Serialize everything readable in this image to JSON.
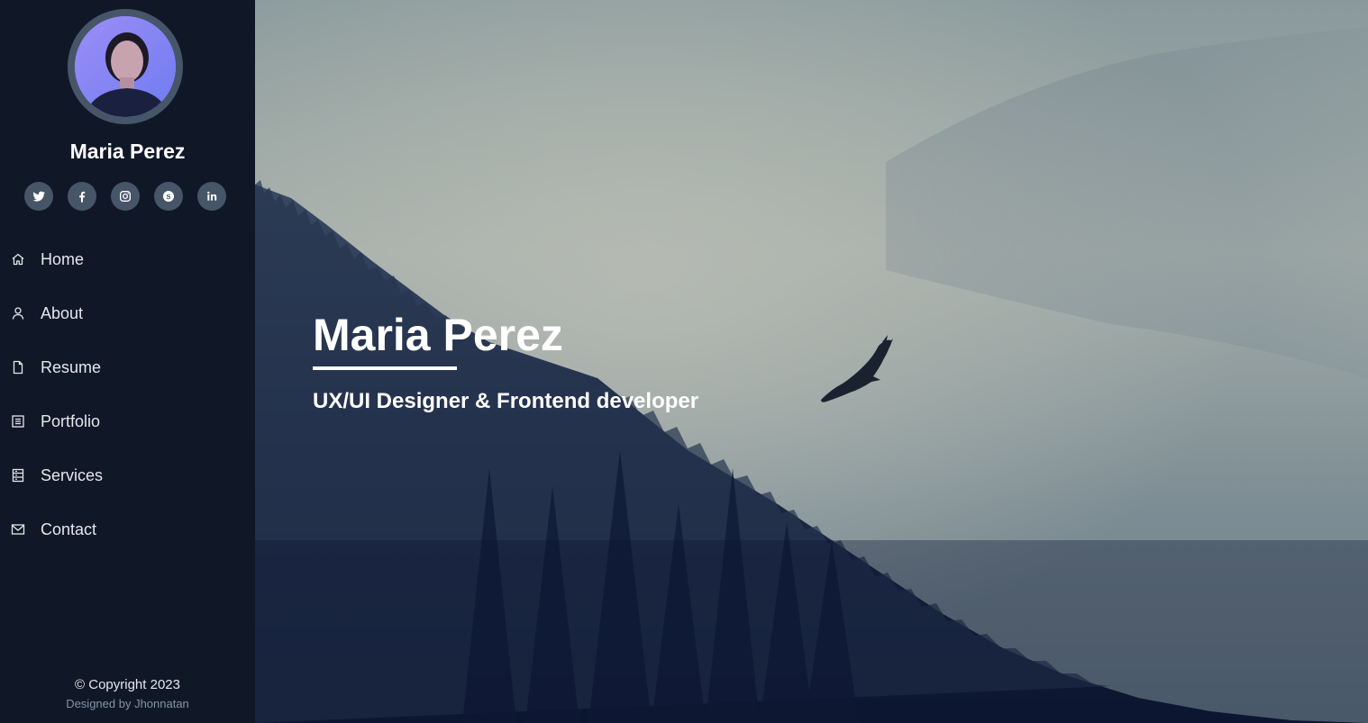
{
  "profile": {
    "name": "Maria Perez",
    "avatar_icon": "portrait-photo"
  },
  "socials": [
    {
      "name": "twitter",
      "icon": "twitter-icon"
    },
    {
      "name": "facebook",
      "icon": "facebook-icon"
    },
    {
      "name": "instagram",
      "icon": "instagram-icon"
    },
    {
      "name": "skype",
      "icon": "skype-icon"
    },
    {
      "name": "linkedin",
      "icon": "linkedin-icon"
    }
  ],
  "nav": {
    "items": [
      {
        "label": "Home",
        "icon": "home-icon"
      },
      {
        "label": "About",
        "icon": "user-icon"
      },
      {
        "label": "Resume",
        "icon": "file-icon"
      },
      {
        "label": "Portfolio",
        "icon": "list-icon"
      },
      {
        "label": "Services",
        "icon": "server-icon"
      },
      {
        "label": "Contact",
        "icon": "envelope-icon"
      }
    ]
  },
  "footer": {
    "copyright": "© Copyright 2023",
    "designed_by": "Designed by Jhonnatan"
  },
  "hero": {
    "title": "Maria Perez",
    "subtitle": "UX/UI Designer & Frontend developer",
    "background": "foggy-forest-with-eagle"
  },
  "colors": {
    "sidebar_bg": "#101828",
    "social_bg": "#475569",
    "text": "#ffffff"
  }
}
